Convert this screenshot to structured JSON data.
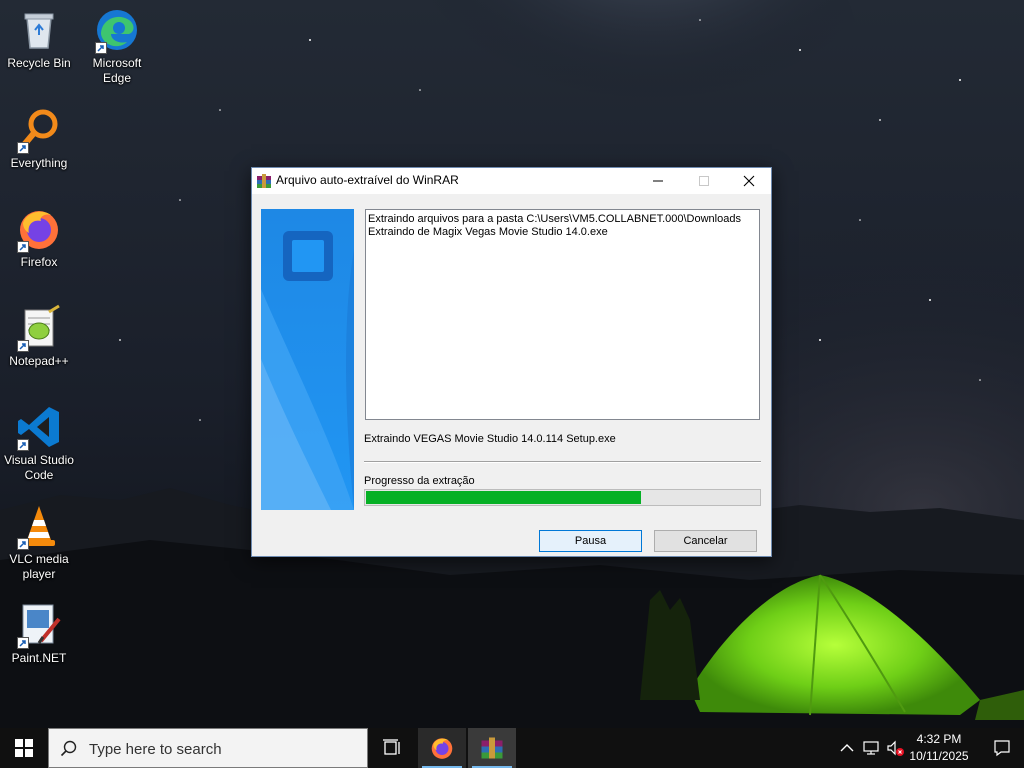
{
  "desktop": {
    "icons": [
      {
        "label": "Recycle Bin",
        "icon": "recycle-bin-icon"
      },
      {
        "label": "Microsoft Edge",
        "icon": "edge-icon"
      },
      {
        "label": "Everything",
        "icon": "everything-icon"
      },
      {
        "label": "Firefox",
        "icon": "firefox-icon"
      },
      {
        "label": "Notepad++",
        "icon": "notepadpp-icon"
      },
      {
        "label": "Visual Studio Code",
        "icon": "vscode-icon"
      },
      {
        "label": "VLC media player",
        "icon": "vlc-icon"
      },
      {
        "label": "Paint.NET",
        "icon": "paintnet-icon"
      }
    ]
  },
  "dialog": {
    "title": "Arquivo auto-extraível do WinRAR",
    "log_lines": [
      "Extraindo arquivos para a pasta C:\\Users\\VM5.COLLABNET.000\\Downloads",
      "Extraindo de Magix Vegas Movie Studio 14.0.exe"
    ],
    "current_file": "Extraindo VEGAS Movie Studio 14.0.114 Setup.exe",
    "progress_label": "Progresso da extração",
    "progress_percent": 70,
    "pause_label": "Pausa",
    "cancel_label": "Cancelar"
  },
  "taskbar": {
    "search_placeholder": "Type here to search",
    "time": "4:32 PM",
    "date": "10/11/2025"
  },
  "colors": {
    "progress_fill": "#06b025",
    "banner_blue": "#1e88e5",
    "taskbar_bg": "#101010"
  }
}
